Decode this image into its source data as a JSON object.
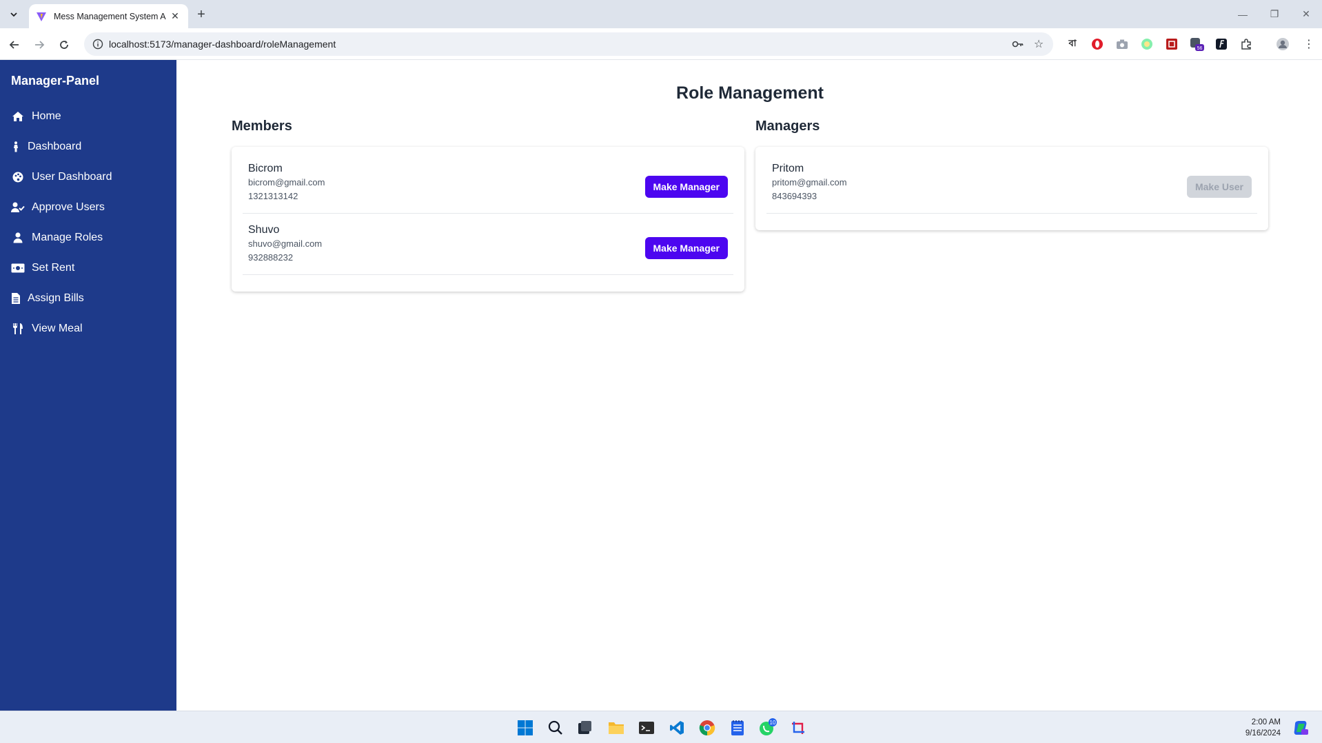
{
  "browser": {
    "tab_title": "Mess Management System Am",
    "url": "localhost:5173/manager-dashboard/roleManagement",
    "ext_bn_label": "বা",
    "ext_badge": "56"
  },
  "sidebar": {
    "brand": "Manager-Panel",
    "items": [
      {
        "label": "Home",
        "icon": "home-icon"
      },
      {
        "label": "Dashboard",
        "icon": "person-walking-icon"
      },
      {
        "label": "User Dashboard",
        "icon": "palette-icon"
      },
      {
        "label": "Approve Users",
        "icon": "user-check-icon"
      },
      {
        "label": "Manage Roles",
        "icon": "user-icon"
      },
      {
        "label": "Set Rent",
        "icon": "money-bill-icon"
      },
      {
        "label": "Assign Bills",
        "icon": "file-icon"
      },
      {
        "label": "View Meal",
        "icon": "utensils-icon"
      }
    ]
  },
  "main": {
    "title": "Role Management",
    "members": {
      "heading": "Members",
      "rows": [
        {
          "name": "Bicrom",
          "email": "bicrom@gmail.com",
          "phone": "1321313142",
          "action": "Make Manager"
        },
        {
          "name": "Shuvo",
          "email": "shuvo@gmail.com",
          "phone": "932888232",
          "action": "Make Manager"
        }
      ]
    },
    "managers": {
      "heading": "Managers",
      "rows": [
        {
          "name": "Pritom",
          "email": "pritom@gmail.com",
          "phone": "843694393",
          "action": "Make User"
        }
      ]
    }
  },
  "taskbar": {
    "time": "2:00 AM",
    "date": "9/16/2024",
    "whatsapp_badge": "10"
  },
  "colors": {
    "sidebar_bg": "#1e3a8a",
    "primary_button": "#4c06f0",
    "disabled_button": "#d1d5db"
  }
}
